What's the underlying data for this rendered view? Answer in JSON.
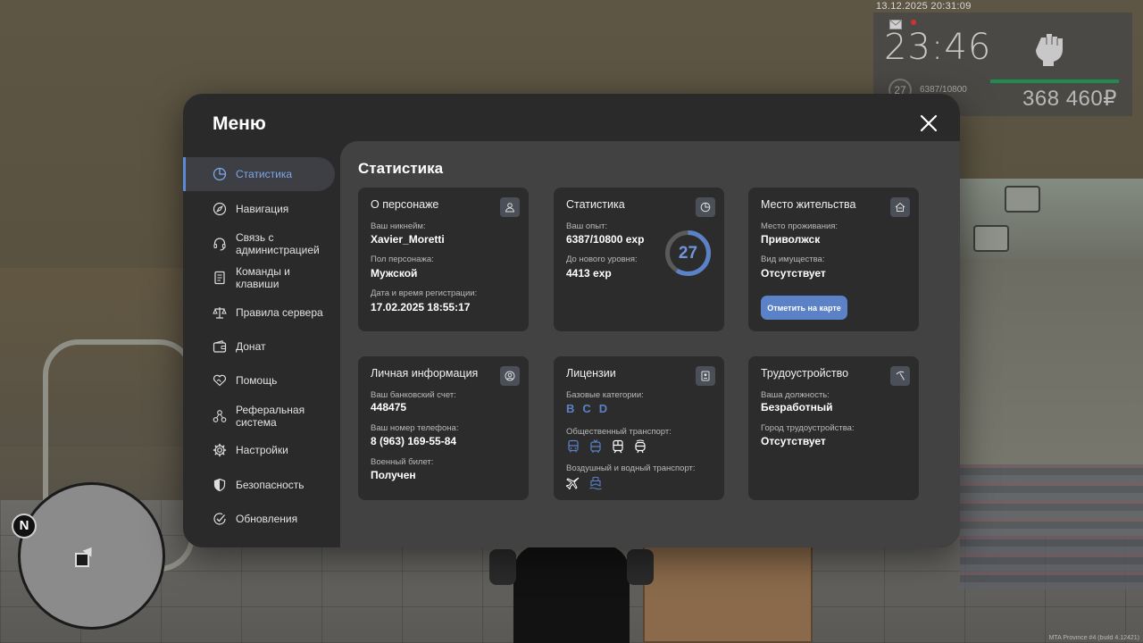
{
  "hud": {
    "datetime": "13.12.2025 20:31:09",
    "clock": "23:46",
    "level": "27",
    "exp": "6387/10800",
    "money": "368 460₽",
    "health_fraction": 1.0
  },
  "minimap": {
    "compass": "N"
  },
  "build_tag": "MTA Province #4 (build 4.12421)",
  "menu": {
    "title": "Меню",
    "sidebar": [
      {
        "label": "Статистика",
        "icon": "pie-chart-icon",
        "active": true
      },
      {
        "label": "Навигация",
        "icon": "compass-icon"
      },
      {
        "label": "Связь с администрацией",
        "icon": "headset-icon"
      },
      {
        "label": "Команды и клавиши",
        "icon": "document-icon"
      },
      {
        "label": "Правила сервера",
        "icon": "scales-icon"
      },
      {
        "label": "Донат",
        "icon": "wallet-icon"
      },
      {
        "label": "Помощь",
        "icon": "handshake-heart-icon"
      },
      {
        "label": "Реферальная система",
        "icon": "network-icon"
      },
      {
        "label": "Настройки",
        "icon": "gear-icon"
      },
      {
        "label": "Безопасность",
        "icon": "shield-icon"
      },
      {
        "label": "Обновления",
        "icon": "check-circle-icon"
      }
    ],
    "content_title": "Статистика",
    "cards": {
      "character": {
        "title": "О персонаже",
        "nickname_label": "Ваш никнейм:",
        "nickname": "Xavier_Moretti",
        "gender_label": "Пол персонажа:",
        "gender": "Мужской",
        "reg_label": "Дата и время регистрации:",
        "reg": "17.02.2025 18:55:17"
      },
      "stats": {
        "title": "Статистика",
        "exp_label": "Ваш опыт:",
        "exp": "6387/10800 exp",
        "next_label": "До нового уровня:",
        "next": "4413 exp",
        "level": "27",
        "level_progress": 0.59
      },
      "residence": {
        "title": "Место жительства",
        "place_label": "Место проживания:",
        "place": "Приволжск",
        "property_label": "Вид имущества:",
        "property": "Отсутствует",
        "map_button": "Отметить на карте"
      },
      "personal": {
        "title": "Личная информация",
        "bank_label": "Ваш банковский счет:",
        "bank": "448475",
        "phone_label": "Ваш номер телефона:",
        "phone": "8 (963) 169-55-84",
        "military_label": "Военный билет:",
        "military": "Получен"
      },
      "licenses": {
        "title": "Лицензии",
        "base_label": "Базовые категории:",
        "base": [
          "B",
          "C",
          "D"
        ],
        "public_label": "Общественный транспорт:",
        "public_icons": [
          "bus-icon",
          "trolleybus-icon",
          "train-icon",
          "tram-icon"
        ],
        "air_label": "Воздушный и водный транспорт:",
        "air_icons": [
          "plane-icon",
          "boat-icon"
        ],
        "owned_color": "#5b82c7",
        "not_owned_color": "#ffffff"
      },
      "employment": {
        "title": "Трудоустройство",
        "position_label": "Ваша должность:",
        "position": "Безработный",
        "city_label": "Город трудоустройства:",
        "city": "Отсутствует"
      }
    }
  },
  "colors": {
    "accent": "#5b82c7",
    "health": "#1f8a52"
  }
}
